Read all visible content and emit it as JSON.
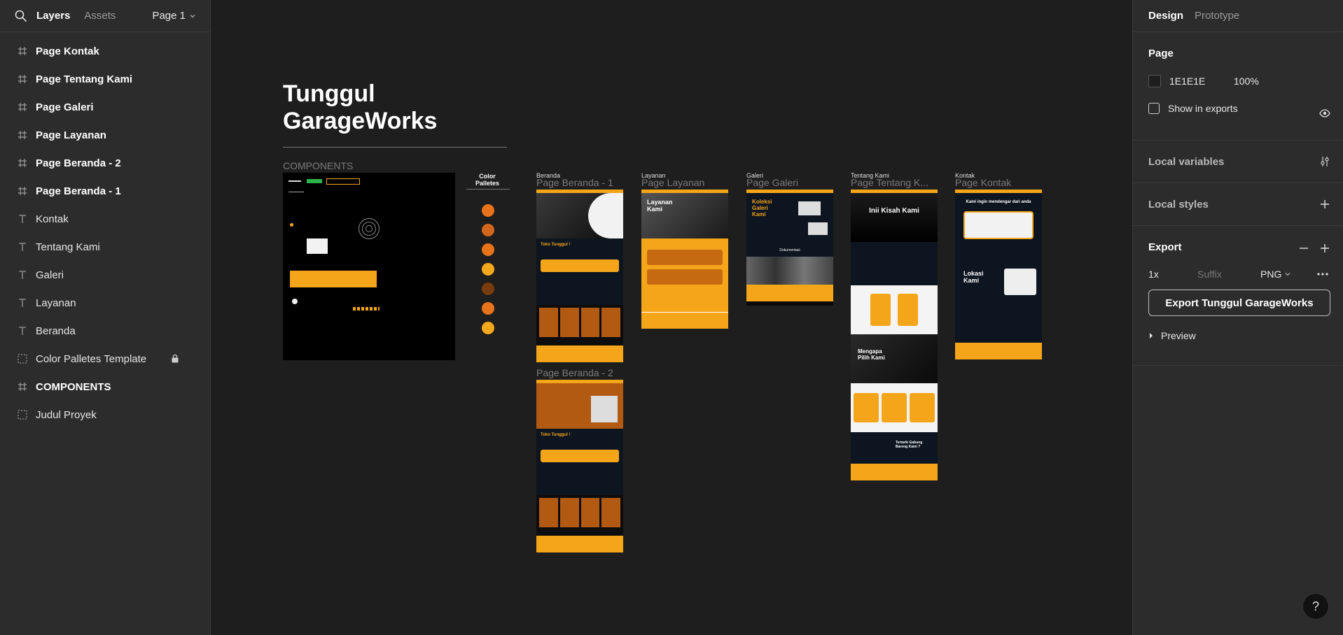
{
  "left_panel": {
    "tabs": [
      "Layers",
      "Assets"
    ],
    "page_selector": "Page 1",
    "layers": [
      {
        "label": "Page Kontak",
        "type": "frame"
      },
      {
        "label": "Page Tentang Kami",
        "type": "frame"
      },
      {
        "label": "Page Galeri",
        "type": "frame"
      },
      {
        "label": "Page Layanan",
        "type": "frame"
      },
      {
        "label": "Page Beranda - 2",
        "type": "frame"
      },
      {
        "label": "Page Beranda - 1",
        "type": "frame"
      },
      {
        "label": "Kontak",
        "type": "text"
      },
      {
        "label": "Tentang Kami",
        "type": "text"
      },
      {
        "label": "Galeri",
        "type": "text"
      },
      {
        "label": "Layanan",
        "type": "text"
      },
      {
        "label": "Beranda",
        "type": "text"
      },
      {
        "label": "Color Palletes Template",
        "type": "section",
        "locked": true
      },
      {
        "label": "COMPONENTS",
        "type": "frame"
      },
      {
        "label": "Judul Proyek",
        "type": "section"
      }
    ]
  },
  "right_panel": {
    "tabs": [
      "Design",
      "Prototype"
    ],
    "page": {
      "title": "Page",
      "color": "1E1E1E",
      "opacity": "100%",
      "show_in_exports": "Show in exports"
    },
    "local_variables": "Local variables",
    "local_styles": "Local styles",
    "export": {
      "title": "Export",
      "scale": "1x",
      "suffix_placeholder": "Suffix",
      "format": "PNG",
      "button": "Export Tunggul GarageWorks",
      "preview": "Preview"
    }
  },
  "canvas": {
    "project_title_line1": "Tunggul",
    "project_title_line2": "GarageWorks",
    "components_label": "COMPONENTS",
    "color_palletes_label": "Color Palletes",
    "palette": [
      "#e8731b",
      "#d2661b",
      "#e8731b",
      "#f2a81d",
      "#7a3b0c",
      "#e8731b",
      "#f2a81d"
    ],
    "frames": [
      {
        "section": "Beranda",
        "name": "Page Beranda - 1"
      },
      {
        "section": "",
        "name": "Page Beranda - 2"
      },
      {
        "section": "Layanan",
        "name": "Page Layanan"
      },
      {
        "section": "Galeri",
        "name": "Page Galeri"
      },
      {
        "section": "Tentang Kami",
        "name": "Page Tentang K..."
      },
      {
        "section": "Kontak",
        "name": "Page Kontak"
      }
    ],
    "frame_text": {
      "b1_toko": "Toko Tunggul !",
      "b2_toko": "Toko Tunggul !",
      "layanan_title": "Layanan Kami",
      "galeri_title": "Koleksi Galeri Kami",
      "galeri_mid": "Dokumentasi",
      "tentang_title": "Inii Kisah Kami",
      "tentang_why": "Mengapa Pilih Kami",
      "tentang_q": "Tertarik Gabung Bareng Kami ?",
      "kontak_head": "Kami ingin mendengar dari anda",
      "kontak_loc": "Lokasi Kami"
    }
  },
  "help_label": "?"
}
